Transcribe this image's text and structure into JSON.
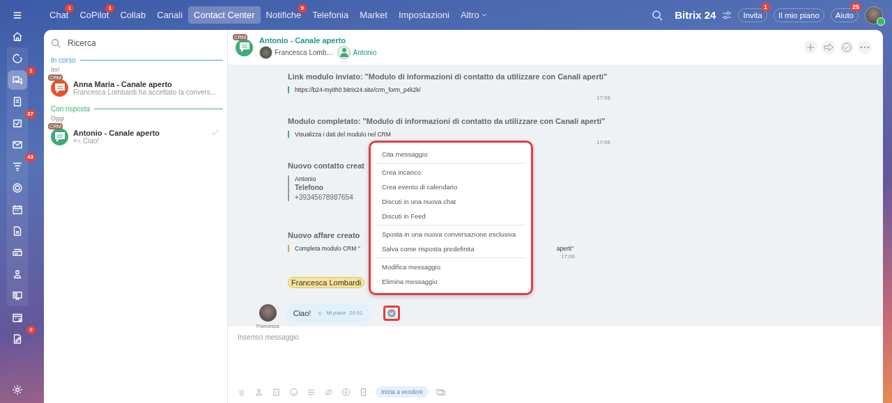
{
  "rail": [
    {
      "kind": "menu",
      "selected": false
    },
    {
      "kind": "home",
      "selected": false
    },
    {
      "kind": "pulse",
      "selected": false
    },
    {
      "kind": "chat",
      "badge": "1",
      "selected": true
    },
    {
      "kind": "doc",
      "selected": false
    },
    {
      "kind": "task",
      "badge": "37",
      "selected": false
    },
    {
      "kind": "mail",
      "selected": false
    },
    {
      "kind": "funnel",
      "badge": "43",
      "selected": false
    },
    {
      "kind": "ring",
      "selected": false
    },
    {
      "kind": "calendar",
      "selected": false
    },
    {
      "kind": "file",
      "selected": false
    },
    {
      "kind": "drive",
      "selected": false
    },
    {
      "kind": "people",
      "selected": false
    },
    {
      "kind": "board",
      "selected": false
    },
    {
      "kind": "schedule",
      "selected": false
    },
    {
      "kind": "sign",
      "badge": "3",
      "selected": false
    },
    {
      "kind": "settings",
      "selected": false
    }
  ],
  "tabs": [
    {
      "label": "Chat",
      "badge": "1",
      "selected": false
    },
    {
      "label": "CoPilot",
      "badge": "1",
      "selected": false
    },
    {
      "label": "Collab",
      "selected": false
    },
    {
      "label": "Canali",
      "selected": false
    },
    {
      "label": "Contact Center",
      "selected": true
    },
    {
      "label": "Notifiche",
      "badge": "9",
      "selected": false
    },
    {
      "label": "Telefonia",
      "selected": false
    },
    {
      "label": "Market",
      "selected": false
    },
    {
      "label": "Impostazioni",
      "selected": false
    },
    {
      "label": "Altro",
      "selected": false
    }
  ],
  "header_right": {
    "logo": "Bitrix 24",
    "buttons": [
      {
        "label": "Invita",
        "badge": "1"
      },
      {
        "label": "Il mio piano"
      },
      {
        "label": "Aiuto",
        "badge": "25"
      }
    ]
  },
  "list": {
    "search": {
      "placeholder": "Ricerca"
    },
    "sections": [
      {
        "title": "In corso",
        "color": "#2fa4d8",
        "day": "Ieri",
        "items": [
          {
            "tag": "CRM",
            "title": "Anna Maria - Canale aperto",
            "preview": "Francesca Lombardi ha accettato la convers...",
            "reply": false,
            "read": false,
            "color": "#e8532b"
          }
        ]
      },
      {
        "title": "Con risposta",
        "color": "#3bb273",
        "day": "Oggi",
        "items": [
          {
            "tag": "CRM",
            "title": "Antonio - Canale aperto",
            "preview": "Ciao!",
            "reply": true,
            "read": true,
            "color": "#3faa78"
          }
        ]
      }
    ]
  },
  "chat": {
    "tag": "CRM",
    "title": "Antonio - Canale aperto",
    "participants": [
      {
        "name": "Francesca Lomb…",
        "kind": "operator"
      },
      {
        "name": "Antonio",
        "kind": "client"
      }
    ],
    "messages": [
      {
        "kind": "quote",
        "title": "Link modulo inviato: \"Modulo di informazioni di contatto da utilizzare con Canali aperti\"",
        "body": "https://b24-myith0.bitrix24.site/crm_form_p4k2k/",
        "color": "#3bb273",
        "time": "17:06"
      },
      {
        "kind": "quote",
        "title": "Modulo completato: \"Modulo di informazioni di contatto da utilizzare con Canali aperti\"",
        "body": "Visualizza i dati del modulo nel CRM",
        "color": "#3bb273",
        "time": "17:06"
      },
      {
        "kind": "contact",
        "title": "Nuovo contatto creat",
        "name": "Antonio",
        "field": "Telefono",
        "value": "+39345678987654",
        "color": "#9a9a9a"
      },
      {
        "kind": "split",
        "title": "Nuovo affare creato",
        "body": "Completa modulo CRM \"",
        "body_end": "aperti\"",
        "color": "#c9a46b",
        "time": "17:06"
      },
      {
        "kind": "mention",
        "title": "Francesca Lombardi"
      }
    ],
    "last": {
      "author": "Francesca",
      "text": "Ciao!",
      "like": "Mi piace",
      "time": "20:51"
    },
    "menu": [
      [
        "Cita messaggio"
      ],
      [
        "Crea incarico",
        "Crea evento di calendario",
        "Discuti in una nuova chat",
        "Discuti in Feed"
      ],
      [
        "Sposta in una nuova conversazione esclusiva",
        "Salva come risposta predefinita"
      ],
      [
        "Modifica messaggio",
        "Elimina messaggio"
      ]
    ],
    "composer": {
      "placeholder": "Inserisci messaggio",
      "sell": "Inizia a vendere"
    }
  }
}
